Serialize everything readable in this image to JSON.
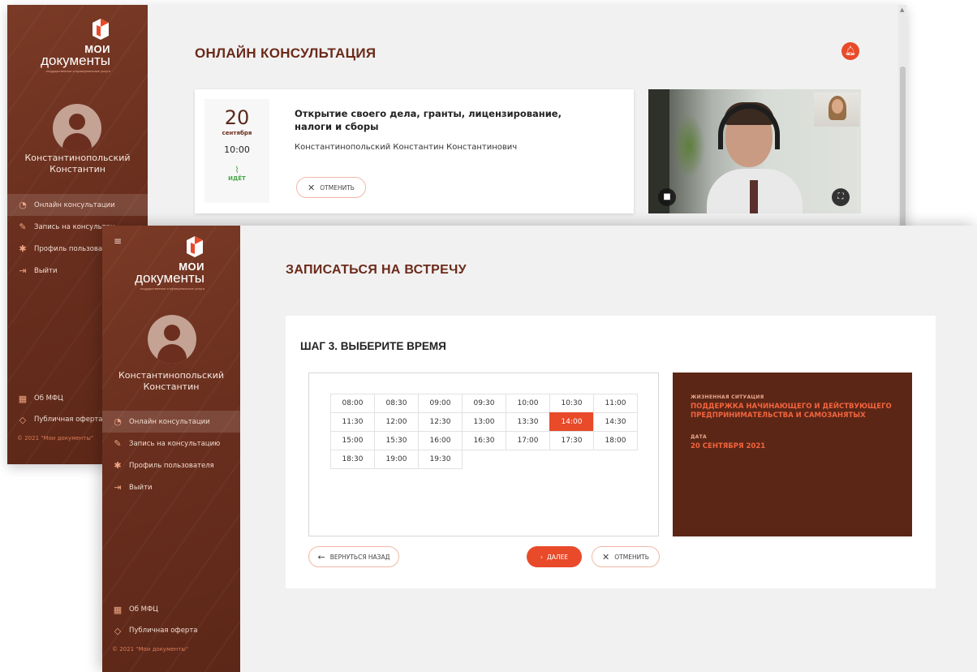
{
  "colors": {
    "brand_dark": "#6b2a1a",
    "accent": "#e84a2a",
    "info_panel": "#5c2616",
    "status_green": "#48a848"
  },
  "logo": {
    "line1": "МОИ",
    "line2": "документы",
    "subtitle": "государственные и муниципальные услуги"
  },
  "user": {
    "name_line1": "Константинопольский",
    "name_line2": "Константин"
  },
  "back_window": {
    "nav": [
      {
        "label": "Онлайн консультации",
        "icon": "chat-icon",
        "active": true
      },
      {
        "label": "Запись на консультац",
        "icon": "pencil-icon"
      },
      {
        "label": "Профиль пользовател",
        "icon": "gear-icon"
      },
      {
        "label": "Выйти",
        "icon": "logout-icon"
      }
    ],
    "bottom_links": [
      {
        "label": "Об МФЦ",
        "icon": "building-icon"
      },
      {
        "label": "Публичная оферта",
        "icon": "tag-icon"
      }
    ],
    "copyright": "© 2021 \"Мои документы\"",
    "page_title": "ОНЛАЙН КОНСУЛЬТАЦИЯ",
    "consultation": {
      "day": "20",
      "month": "сентября",
      "time": "10:00",
      "status": "ИДЁТ",
      "title": "Открытие своего дела, гранты, лицензирование, налоги и сборы",
      "consultant": "Константинопольский Константин Константинович",
      "cancel_label": "ОТМЕНИТЬ"
    }
  },
  "front_window": {
    "nav": [
      {
        "label": "Онлайн консультации",
        "icon": "chat-icon",
        "active": true
      },
      {
        "label": "Запись на консультацию",
        "icon": "pencil-icon"
      },
      {
        "label": "Профиль пользователя",
        "icon": "gear-icon"
      },
      {
        "label": "Выйти",
        "icon": "logout-icon"
      }
    ],
    "bottom_links": [
      {
        "label": "Об МФЦ",
        "icon": "building-icon"
      },
      {
        "label": "Публичная оферта",
        "icon": "tag-icon"
      }
    ],
    "copyright": "© 2021 \"Мои документы\"",
    "page_title": "ЗАПИСАТЬСЯ НА ВСТРЕЧУ",
    "step_title": "ШАГ 3. ВЫБЕРИТЕ ВРЕМЯ",
    "time_slots": [
      "08:00",
      "08:30",
      "09:00",
      "09:30",
      "10:00",
      "10:30",
      "11:00",
      "11:30",
      "12:00",
      "12:30",
      "13:00",
      "13:30",
      "14:00",
      "14:30",
      "15:00",
      "15:30",
      "16:00",
      "16:30",
      "17:00",
      "17:30",
      "18:00",
      "18:30",
      "19:00",
      "19:30"
    ],
    "selected_slot": "14:00",
    "info": {
      "situation_label": "ЖИЗНЕННАЯ СИТУАЦИЯ",
      "situation_value": "ПОДДЕРЖКА НАЧИНАЮЩЕГО И ДЕЙСТВУЮЩЕГО ПРЕДПРИНИМАТЕЛЬСТВА И САМОЗАНЯТЫХ",
      "date_label": "ДАТА",
      "date_value": "20 СЕНТЯБРЯ 2021"
    },
    "buttons": {
      "back": "ВЕРНУТЬСЯ НАЗАД",
      "next": "ДАЛЕЕ",
      "cancel": "ОТМЕНИТЬ"
    }
  }
}
